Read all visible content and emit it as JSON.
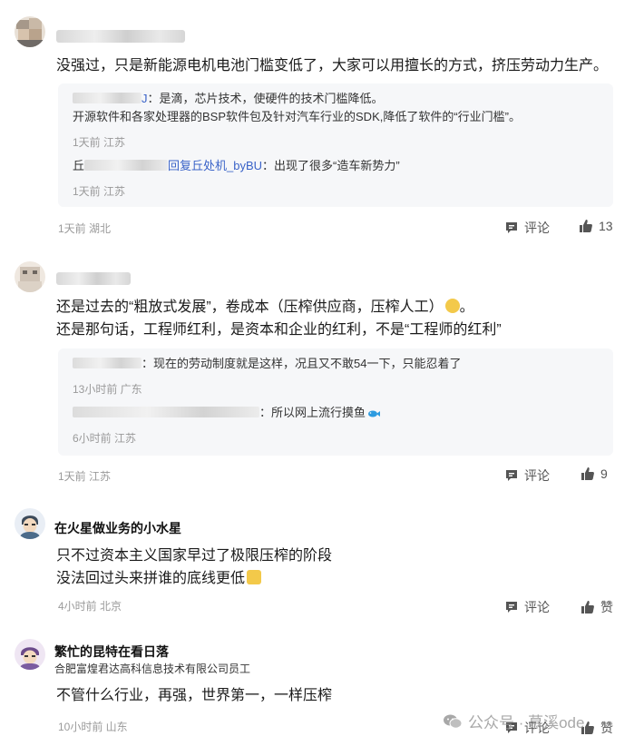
{
  "comments": [
    {
      "text": [
        "没强过，只是新能源电机电池门槛变低了，大家可以用擅长的方式，挤压劳动力生产。"
      ],
      "replies": [
        {
          "author_suffix": "J",
          "text_line1": "：是滴，芯片技术，使硬件的技术门槛降低。",
          "text_line2": "开源软件和各家处理器的BSP软件包及针对汽车行业的SDK,降低了软件的“行业门槛”。",
          "meta": "1天前 江苏"
        },
        {
          "author_prefix": "丘",
          "reply_to": "回复丘处机_byBU",
          "text_line1": "：出现了很多“造车新势力”",
          "meta": "1天前 江苏"
        }
      ],
      "meta": "1天前 湖北",
      "comment_label": "评论",
      "like_count": "13"
    },
    {
      "text": [
        "还是过去的“粗放式发展”，卷成本（压榨供应商，压榨人工）",
        "还是那句话，工程师红利，是资本和企业的红利，不是“工程师的红利”"
      ],
      "text_line1_end": "。",
      "replies": [
        {
          "text_line1": "：现在的劳动制度就是这样，况且又不敢54一下，只能忍着了",
          "meta": "13小时前 广东"
        },
        {
          "text_line1": "：所以网上流行摸鱼",
          "meta": "6小时前 江苏"
        }
      ],
      "meta": "1天前 江苏",
      "comment_label": "评论",
      "like_count": "9"
    },
    {
      "author": "在火星做业务的小水星",
      "text": [
        "只不过资本主义国家早过了极限压榨的阶段",
        "没法回过头来拼谁的底线更低"
      ],
      "meta": "4小时前 北京",
      "comment_label": "评论",
      "like_label": "赞"
    },
    {
      "author": "繁忙的昆特在看日落",
      "org": "合肥富煌君达高科信息技术有限公司员工",
      "text": [
        "不管什么行业，再强，世界第一，一样压榨"
      ],
      "meta": "10小时前 山东",
      "comment_label": "评论",
      "like_label": "赞"
    }
  ],
  "watermark": {
    "text": "公众号 · 慕溪ode"
  },
  "colors": {
    "link": "#3a63c8",
    "meta": "#9a9a9a",
    "reply_bg": "#f6f7f9"
  },
  "icons": [
    "comment-icon",
    "thumbs-up-icon",
    "wechat-icon"
  ]
}
